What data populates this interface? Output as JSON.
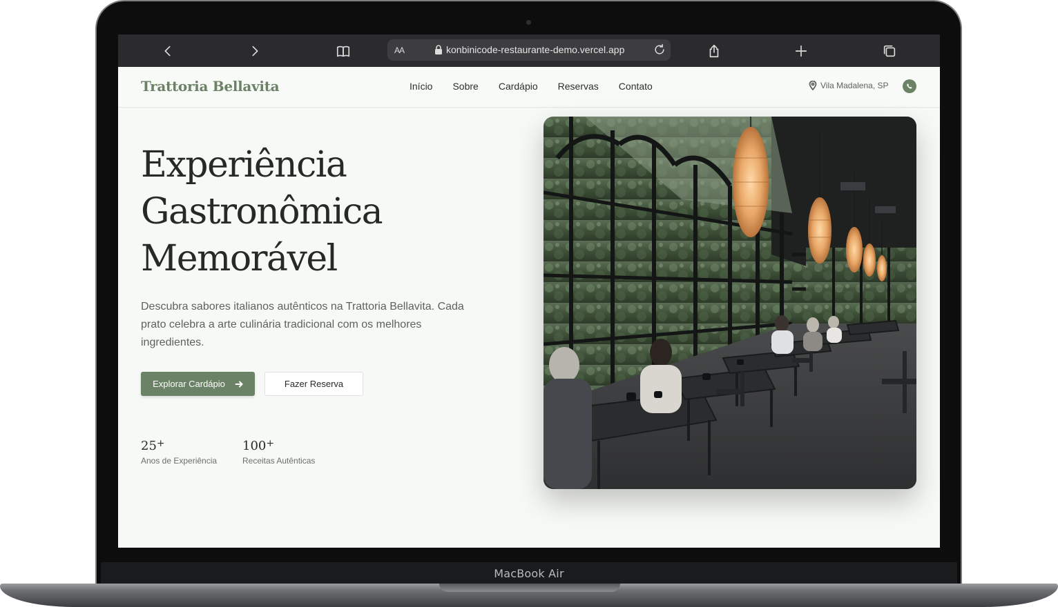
{
  "device": {
    "label": "MacBook Air"
  },
  "browser": {
    "aa_label": "AA",
    "url": "konbinicode-restaurante-demo.vercel.app"
  },
  "site": {
    "brand": "Trattoria Bellavita",
    "nav": [
      "Início",
      "Sobre",
      "Cardápio",
      "Reservas",
      "Contato"
    ],
    "location": "Vila Madalena, SP",
    "brand_color": "#6b8266"
  },
  "hero": {
    "title_lines": [
      "Experiência",
      "Gastronômica",
      "Memorável"
    ],
    "description": "Descubra sabores italianos autênticos na Trattoria Bellavita. Cada prato celebra a arte culinária tradicional com os melhores ingredientes.",
    "primary_button": "Explorar Cardápio",
    "secondary_button": "Fazer Reserva",
    "stats": [
      {
        "value": "25",
        "suffix": "+",
        "label": "Anos de Experiência"
      },
      {
        "value": "100",
        "suffix": "+",
        "label": "Receitas Autênticas"
      }
    ]
  }
}
